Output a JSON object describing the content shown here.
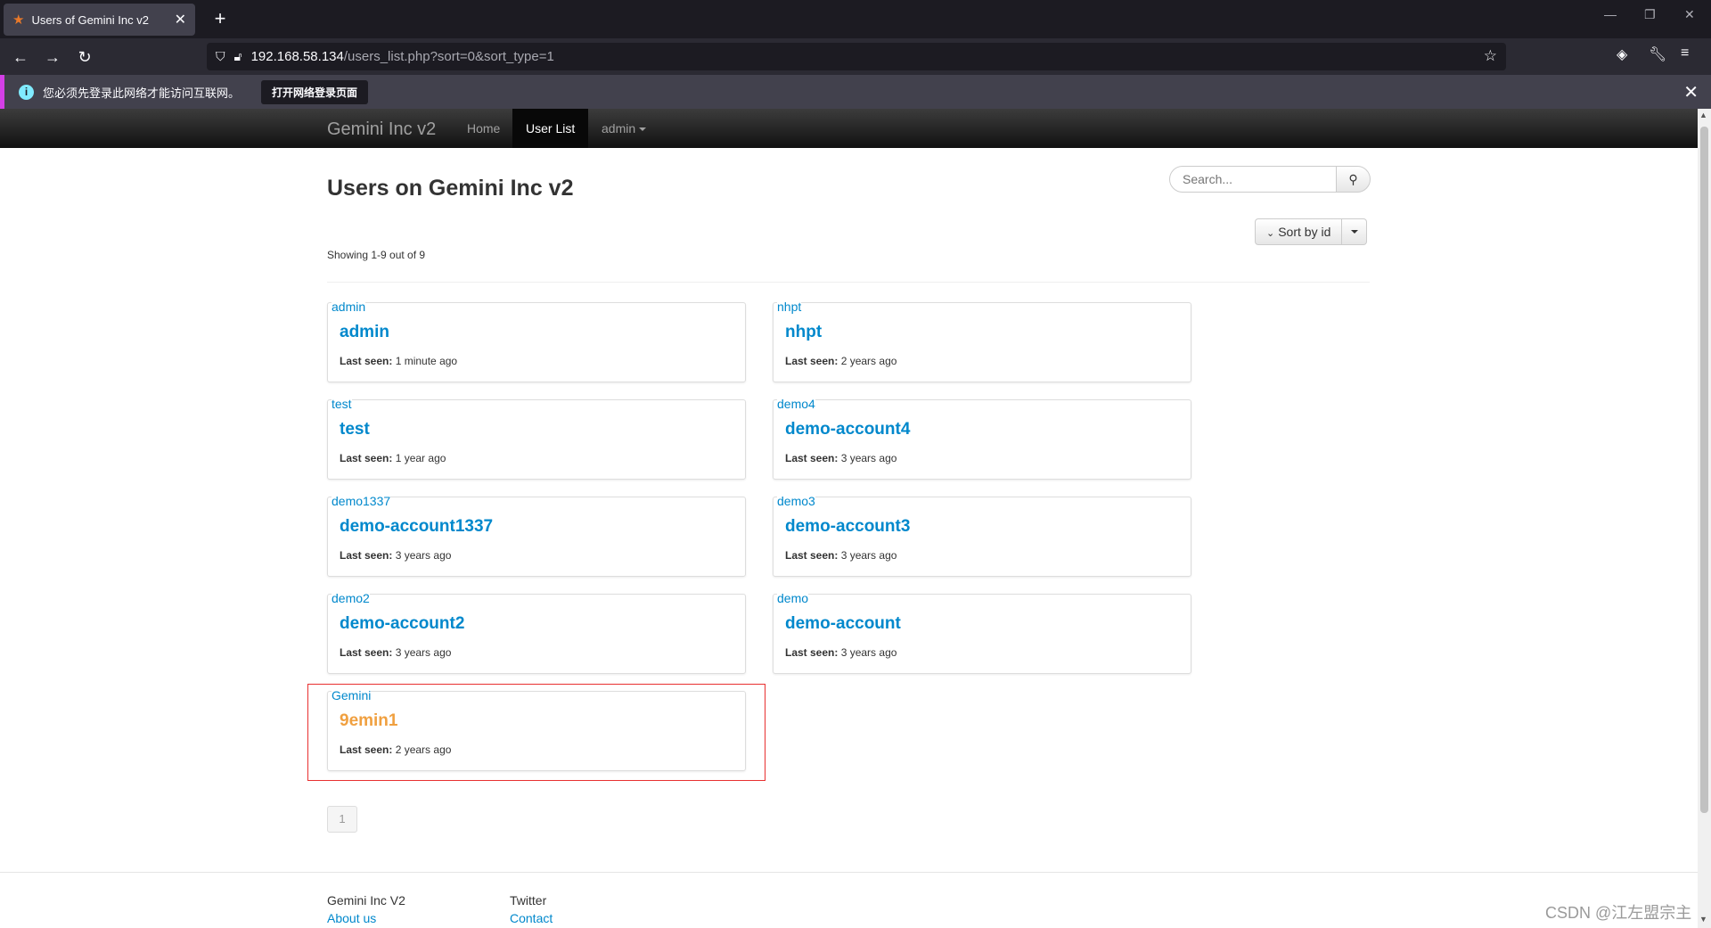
{
  "browser": {
    "tab_title": "Users of Gemini Inc v2",
    "url_host": "192.168.58.134",
    "url_path": "/users_list.php?sort=0&sort_type=1",
    "notification_text": "您必须先登录此网络才能访问互联网。",
    "notification_button": "打开网络登录页面"
  },
  "site": {
    "brand": "Gemini Inc v2",
    "nav": {
      "home": "Home",
      "user_list": "User List",
      "admin": "admin"
    }
  },
  "main": {
    "title": "Users on Gemini Inc v2",
    "search_placeholder": "Search...",
    "sort_label": "Sort by id",
    "showing": "Showing 1-9 out of 9",
    "users": [
      {
        "username": "admin",
        "display": "admin",
        "last_seen_label": "Last seen:",
        "last_seen": "1 minute ago"
      },
      {
        "username": "nhpt",
        "display": "nhpt",
        "last_seen_label": "Last seen:",
        "last_seen": "2 years ago"
      },
      {
        "username": "test",
        "display": "test",
        "last_seen_label": "Last seen:",
        "last_seen": "1 year ago"
      },
      {
        "username": "demo4",
        "display": "demo-account4",
        "last_seen_label": "Last seen:",
        "last_seen": "3 years ago"
      },
      {
        "username": "demo1337",
        "display": "demo-account1337",
        "last_seen_label": "Last seen:",
        "last_seen": "3 years ago"
      },
      {
        "username": "demo3",
        "display": "demo-account3",
        "last_seen_label": "Last seen:",
        "last_seen": "3 years ago"
      },
      {
        "username": "demo2",
        "display": "demo-account2",
        "last_seen_label": "Last seen:",
        "last_seen": "3 years ago"
      },
      {
        "username": "demo",
        "display": "demo-account",
        "last_seen_label": "Last seen:",
        "last_seen": "3 years ago"
      },
      {
        "username": "Gemini",
        "display": "9emin1",
        "last_seen_label": "Last seen:",
        "last_seen": "2 years ago"
      }
    ],
    "page_number": "1"
  },
  "footer": {
    "col1_title": "Gemini Inc V2",
    "col1_link": "About us",
    "col2_title": "Twitter",
    "col2_link": "Contact"
  },
  "watermark": "CSDN @江左盟宗主",
  "colors": {
    "link": "#0088cc",
    "highlight_name": "#f0a040",
    "annotation_box": "#e83030"
  }
}
